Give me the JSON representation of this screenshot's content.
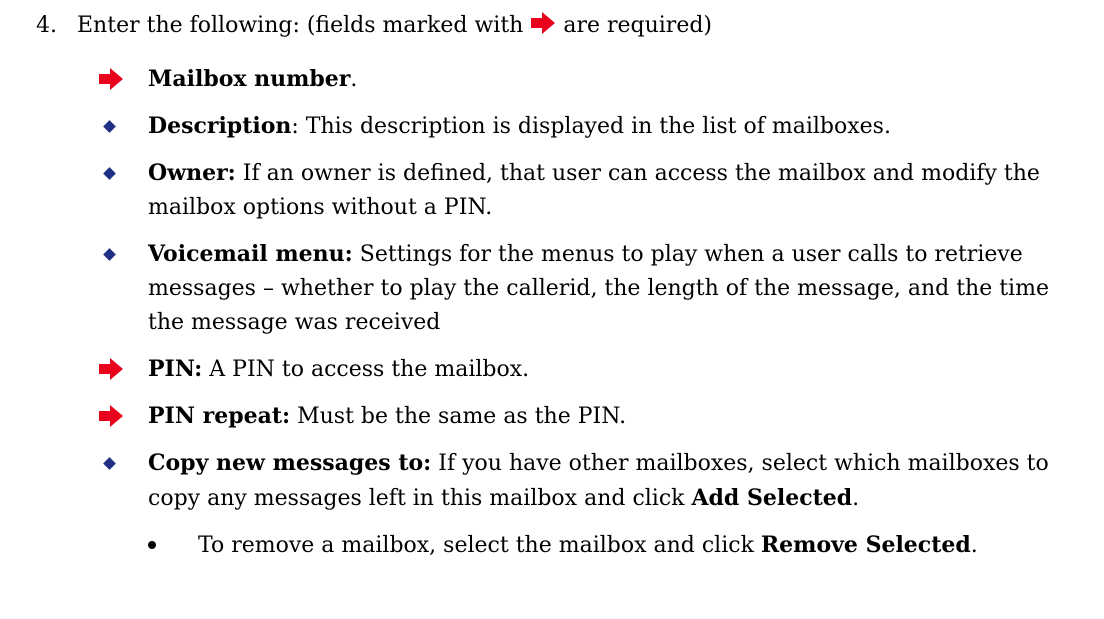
{
  "step": {
    "number": "4.",
    "intro_before": "Enter the following: (fields marked with",
    "intro_after": "are required)"
  },
  "items": [
    {
      "marker": "arrow",
      "bold": "Mailbox number",
      "text": "."
    },
    {
      "marker": "diamond",
      "bold": "Description",
      "text": ": This description is displayed in the list of mailboxes."
    },
    {
      "marker": "diamond",
      "bold": "Owner:",
      "text": " If an owner is defined, that user can access the mailbox and modify the mailbox options without a PIN."
    },
    {
      "marker": "diamond",
      "bold": "Voicemail menu:",
      "text": " Settings for the menus to play when a user calls to retrieve messages – whether to play the callerid, the length of the message, and the time the message was received"
    },
    {
      "marker": "arrow",
      "bold": "PIN:",
      "text": " A PIN to access the mailbox."
    },
    {
      "marker": "arrow",
      "bold": "PIN repeat:",
      "text": " Must be the same as the PIN."
    },
    {
      "marker": "diamond",
      "bold": "Copy new messages to:",
      "text": " If you have other mailboxes, select which mailboxes to copy any messages left in this mailbox and click ",
      "bold2": "Add Selected",
      "text2": "."
    }
  ],
  "subitem": {
    "text": "To remove a mailbox, select the mailbox and click ",
    "bold": "Remove Selected",
    "end": "."
  },
  "colors": {
    "arrow": "#e8001c",
    "diamond": "#1f2f86"
  }
}
